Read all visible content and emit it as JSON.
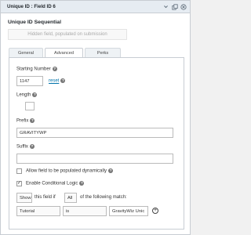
{
  "header": {
    "title": "Unique ID : Field ID 6",
    "icons": [
      "chevron-down-icon",
      "duplicate-icon",
      "delete-icon"
    ]
  },
  "field": {
    "label": "Unique ID Sequential",
    "placeholder_text": "Hidden field, populated on submission"
  },
  "tabs": [
    {
      "label": "General",
      "active": false
    },
    {
      "label": "Advanced",
      "active": true
    },
    {
      "label": "Perks",
      "active": false
    }
  ],
  "advanced": {
    "starting_number_label": "Starting Number",
    "starting_number_value": "1147",
    "reset_link": "reset",
    "length_label": "Length",
    "length_value": "",
    "prefix_label": "Prefix",
    "prefix_value": "GRAVITYWP",
    "suffix_label": "Suffix",
    "suffix_value": "",
    "allow_dynamic_label": "Allow field to be populated dynamically",
    "allow_dynamic_checked": false,
    "conditional_logic_label": "Enable Conditional Logic",
    "conditional_logic_checked": true,
    "cond_action": "Show",
    "cond_this_field_if": "this field if",
    "cond_logic_type": "All",
    "cond_of_following": "of the following match:",
    "rule_field": "Tutorial",
    "rule_operator": "is",
    "rule_value": "GravityWiz Unic"
  }
}
